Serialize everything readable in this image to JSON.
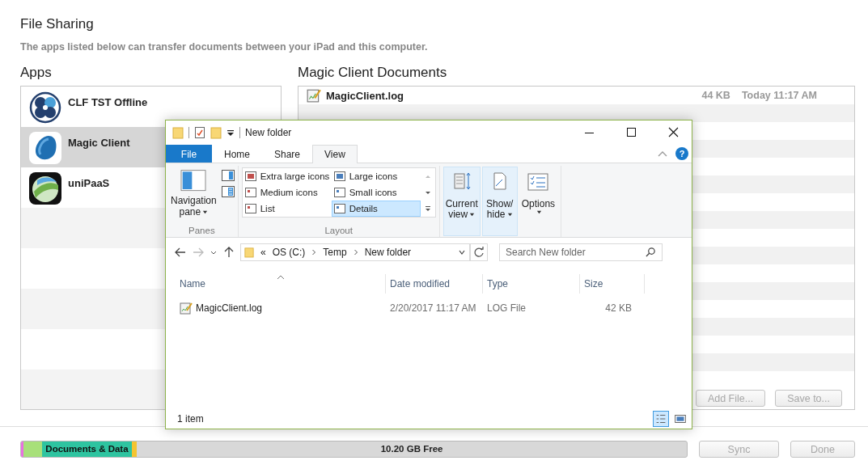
{
  "header": {
    "title": "File Sharing",
    "subtitle": "The apps listed below can transfer documents between your iPad and this computer."
  },
  "apps": {
    "heading": "Apps",
    "items": [
      {
        "name": "CLF TST Offline",
        "selected": false
      },
      {
        "name": "Magic Client",
        "selected": true
      },
      {
        "name": "uniPaaS",
        "selected": false
      }
    ]
  },
  "documents": {
    "heading": "Magic Client Documents",
    "files": [
      {
        "name": "MagicClient.log",
        "size": "44 KB",
        "modified": "Today 11:17 AM"
      }
    ],
    "buttons": [
      {
        "label": "Add File...",
        "disabled": true
      },
      {
        "label": "Save to...",
        "disabled": true
      }
    ]
  },
  "storage": {
    "segments": [
      {
        "color": "#e870e0",
        "level": 0.004
      },
      {
        "color": "#a8e07a",
        "level": 0.027
      },
      {
        "color": "#2ec4a0",
        "level": 0.136,
        "label": "Documents & Data"
      },
      {
        "color": "#f4c430",
        "level": 0.007
      }
    ],
    "free_label": "10.20 GB Free"
  },
  "footer_buttons": [
    {
      "label": "Sync",
      "disabled": true
    },
    {
      "label": "Done",
      "disabled": true
    }
  ],
  "explorer": {
    "window": {
      "title": "New folder"
    },
    "ribbon_tabs": [
      {
        "label": "File",
        "kind": "backstage",
        "selected": false
      },
      {
        "label": "Home",
        "kind": "tab",
        "selected": false
      },
      {
        "label": "Share",
        "kind": "tab",
        "selected": false
      },
      {
        "label": "View",
        "kind": "tab",
        "selected": true
      }
    ],
    "help": "?",
    "panes": {
      "label": "Panes",
      "navigation_pane": [
        "Navigation",
        "pane"
      ]
    },
    "layout": {
      "label": "Layout",
      "options": [
        {
          "label": "Extra large icons",
          "selected": false
        },
        {
          "label": "Large icons",
          "selected": false
        },
        {
          "label": "Medium icons",
          "selected": false
        },
        {
          "label": "Small icons",
          "selected": false
        },
        {
          "label": "List",
          "selected": false
        },
        {
          "label": "Details",
          "selected": true
        }
      ]
    },
    "view_buttons": [
      {
        "lines": [
          "Current",
          "view"
        ],
        "highlighted": true
      },
      {
        "lines": [
          "Show/",
          "hide"
        ],
        "highlighted": true
      },
      {
        "lines": [
          "Options"
        ],
        "highlighted": false
      }
    ],
    "address": {
      "overflow": "«",
      "path": [
        "OS (C:)",
        "Temp",
        "New folder"
      ]
    },
    "search": {
      "placeholder": "Search New folder"
    },
    "columns": [
      "Name",
      "Date modified",
      "Type",
      "Size"
    ],
    "files": [
      {
        "name": "MagicClient.log",
        "modified": "2/20/2017 11:17 AM",
        "type": "LOG File",
        "size": "42 KB"
      }
    ],
    "status": "1 item",
    "view_modes": [
      {
        "selected": true
      },
      {
        "selected": false
      }
    ]
  }
}
